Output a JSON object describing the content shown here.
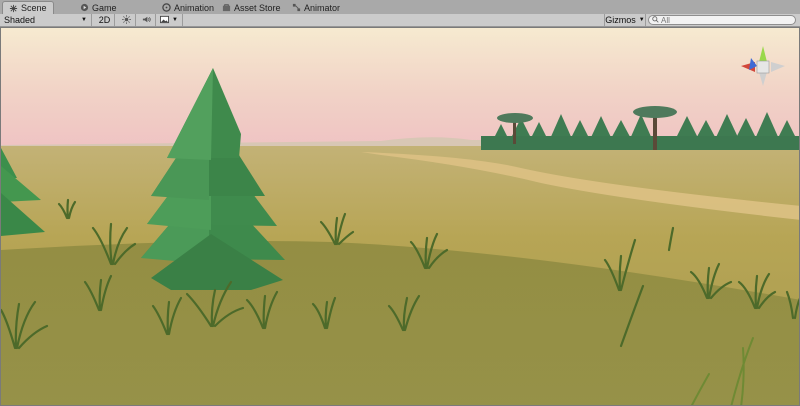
{
  "tabs": [
    {
      "label": "Scene",
      "icon": "scene-icon",
      "active": true
    },
    {
      "label": "Game",
      "icon": "game-icon",
      "active": false
    },
    {
      "label": "Animation",
      "icon": "animation-icon",
      "active": false
    },
    {
      "label": "Asset Store",
      "icon": "asset-store-icon",
      "active": false
    },
    {
      "label": "Animator",
      "icon": "animator-icon",
      "active": false
    }
  ],
  "toolbar": {
    "draw_mode": "Shaded",
    "mode_2d": "2D",
    "gizmos": "Gizmos",
    "search_placeholder": "All"
  },
  "scene": {
    "sky_top": "#f6ead0",
    "sky_bottom": "#efc3c3",
    "ground": "#b7a85a",
    "tree_green": "#3f8e4f"
  }
}
